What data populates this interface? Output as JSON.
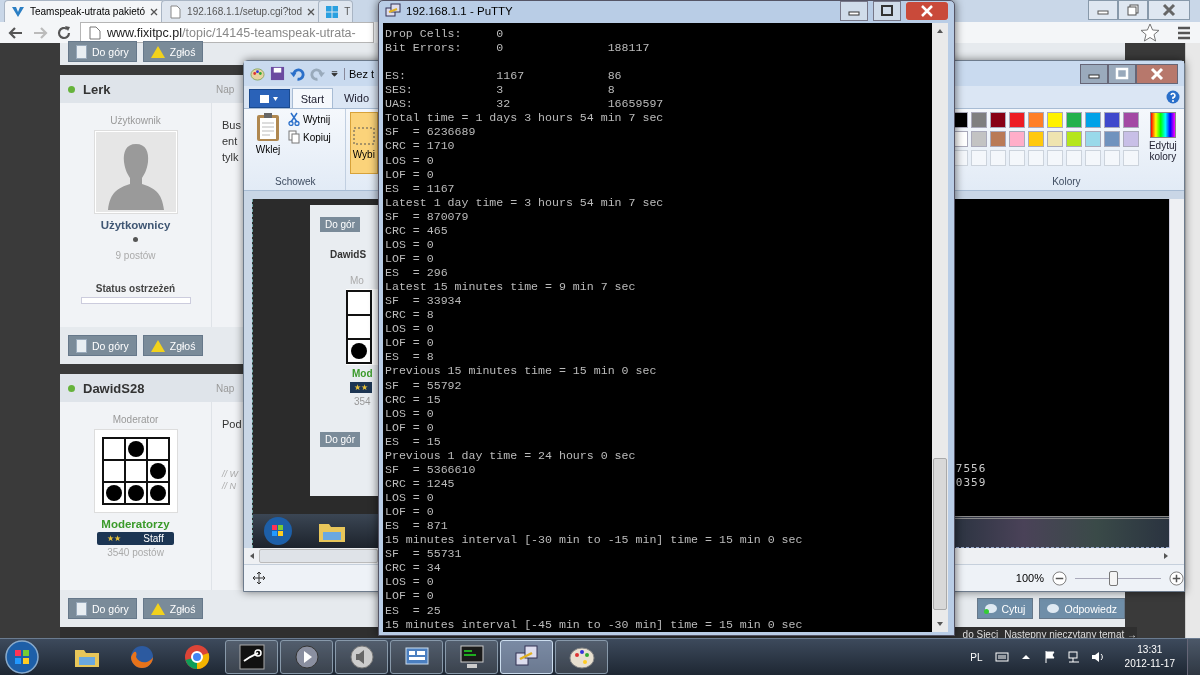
{
  "browser": {
    "tabs": [
      {
        "title": "Teamspeak-utrata pakietó",
        "selected": true
      },
      {
        "title": "192.168.1.1/setup.cgi?tod",
        "selected": false
      },
      {
        "title": "T",
        "selected": false
      }
    ],
    "url": {
      "domain": "www.fixitpc.pl",
      "path": "/topic/14145-teamspeak-utrata-"
    },
    "forum": {
      "top_actions": [
        {
          "label": "Do góry",
          "kind": "top"
        },
        {
          "label": "Zgłoś",
          "kind": "report"
        }
      ],
      "posts": [
        {
          "author": "Lerk",
          "date_cut": "Nap",
          "role": "Użytkownik",
          "group": "Użytkownicy",
          "posts": "9 postów",
          "warning": {
            "label": "Status ostrzeżeń",
            "level": 0
          },
          "body": [
            "Bus",
            "ent",
            "tylk"
          ],
          "actions": [
            {
              "label": "Do góry",
              "kind": "top"
            },
            {
              "label": "Zgłoś",
              "kind": "report"
            }
          ]
        },
        {
          "author": "DawidS28",
          "date_cut": "Nap",
          "role": "Moderator",
          "group": "Moderatorzy",
          "badge": {
            "stars": "★★",
            "label": "Staff"
          },
          "posts": "3540 postów",
          "body": [
            "Pod"
          ],
          "signature": [
            "// W",
            "// N"
          ],
          "actions": [
            {
              "label": "Do góry",
              "kind": "top"
            },
            {
              "label": "Zgłoś",
              "kind": "report"
            }
          ],
          "reply_actions": [
            {
              "label": "Cytuj",
              "kind": "quote"
            },
            {
              "label": "Odpowiedz",
              "kind": "reply"
            }
          ]
        }
      ]
    },
    "footer": {
      "back": "do Sieci",
      "next": "Nastepny nieczytany temat →"
    }
  },
  "paint": {
    "title": "Bez t",
    "tabs": [
      {
        "label": "Start",
        "selected": true
      },
      {
        "label": "Wido",
        "selected": false
      }
    ],
    "clipboard": {
      "paste": "Wklej",
      "cut": "Wytnij",
      "copy": "Kopiuj",
      "group": "Schowek"
    },
    "select": "Wybi",
    "colors": {
      "row_1": [
        {
          "color": "#000000"
        },
        {
          "color": "#7f7f7f"
        },
        {
          "color": "#880015"
        },
        {
          "color": "#ed1c24"
        },
        {
          "color": "#ff7f27"
        },
        {
          "color": "#fff200"
        },
        {
          "color": "#22b14c"
        },
        {
          "color": "#00a2e8"
        },
        {
          "color": "#3f48cc"
        },
        {
          "color": "#a349a4"
        }
      ],
      "row_2": [
        {
          "color": "#ffffff"
        },
        {
          "color": "#c3c3c3"
        },
        {
          "color": "#b97a57"
        },
        {
          "color": "#ffaec9"
        },
        {
          "color": "#ffc90e"
        },
        {
          "color": "#efe4b0"
        },
        {
          "color": "#b5e61d"
        },
        {
          "color": "#99d9ea"
        },
        {
          "color": "#7092be"
        },
        {
          "color": "#c8bfe7"
        }
      ],
      "edit": "Edytuj kolory",
      "group": "Kolory"
    },
    "canvas_left": {
      "top_button": "Do gór",
      "author": "DawidS",
      "role": "Mo",
      "group": "Mod",
      "stars": "★★",
      "posts": "354",
      "bottom_button": "Do gór"
    },
    "canvas_right": {
      "numbers": [
        "7556",
        "0359"
      ]
    },
    "zoom": {
      "reading": "100%",
      "level": 0.45
    }
  },
  "putty": {
    "title": "192.168.1.1 - PuTTY",
    "blocks": [
      [
        "Drop Cells:     0",
        "Bit Errors:     0               188117"
      ],
      [
        "ES:             1167            86",
        "SES:            3               8",
        "UAS:            32              16659597",
        "Total time = 1 days 3 hours 54 min 7 sec",
        "SF  = 6236689",
        "CRC = 1710",
        "LOS = 0",
        "LOF = 0",
        "ES  = 1167",
        "Latest 1 day time = 3 hours 54 min 7 sec",
        "SF  = 870079",
        "CRC = 465",
        "LOS = 0",
        "LOF = 0",
        "ES  = 296",
        "Latest 15 minutes time = 9 min 7 sec",
        "SF  = 33934",
        "CRC = 8",
        "LOS = 0",
        "LOF = 0",
        "ES  = 8",
        "Previous 15 minutes time = 15 min 0 sec",
        "SF  = 55792",
        "CRC = 15",
        "LOS = 0",
        "LOF = 0",
        "ES  = 15",
        "Previous 1 day time = 24 hours 0 sec",
        "SF  = 5366610",
        "CRC = 1245",
        "LOS = 0",
        "LOF = 0",
        "ES  = 871",
        "15 minutes interval [-30 min to -15 min] time = 15 min 0 sec",
        "SF  = 55731",
        "CRC = 34",
        "LOS = 0",
        "LOF = 0",
        "ES  = 25",
        "15 minutes interval [-45 min to -30 min] time = 15 min 0 sec"
      ]
    ]
  },
  "taskbar": {
    "apps": [
      {
        "kind": "folder",
        "running": false,
        "active": false
      },
      {
        "kind": "firefox",
        "running": false,
        "active": false
      },
      {
        "kind": "chrome",
        "running": false,
        "active": false
      },
      {
        "kind": "steam",
        "running": true,
        "active": false
      },
      {
        "kind": "media",
        "running": true,
        "active": false
      },
      {
        "kind": "speaker",
        "running": true,
        "active": false
      },
      {
        "kind": "network",
        "running": true,
        "active": false
      },
      {
        "kind": "monitor",
        "running": true,
        "active": false
      },
      {
        "kind": "putty",
        "running": true,
        "active": true
      },
      {
        "kind": "paint",
        "running": true,
        "active": false
      }
    ],
    "language": "PL",
    "time": "13:31",
    "date": "2012-11-17"
  }
}
